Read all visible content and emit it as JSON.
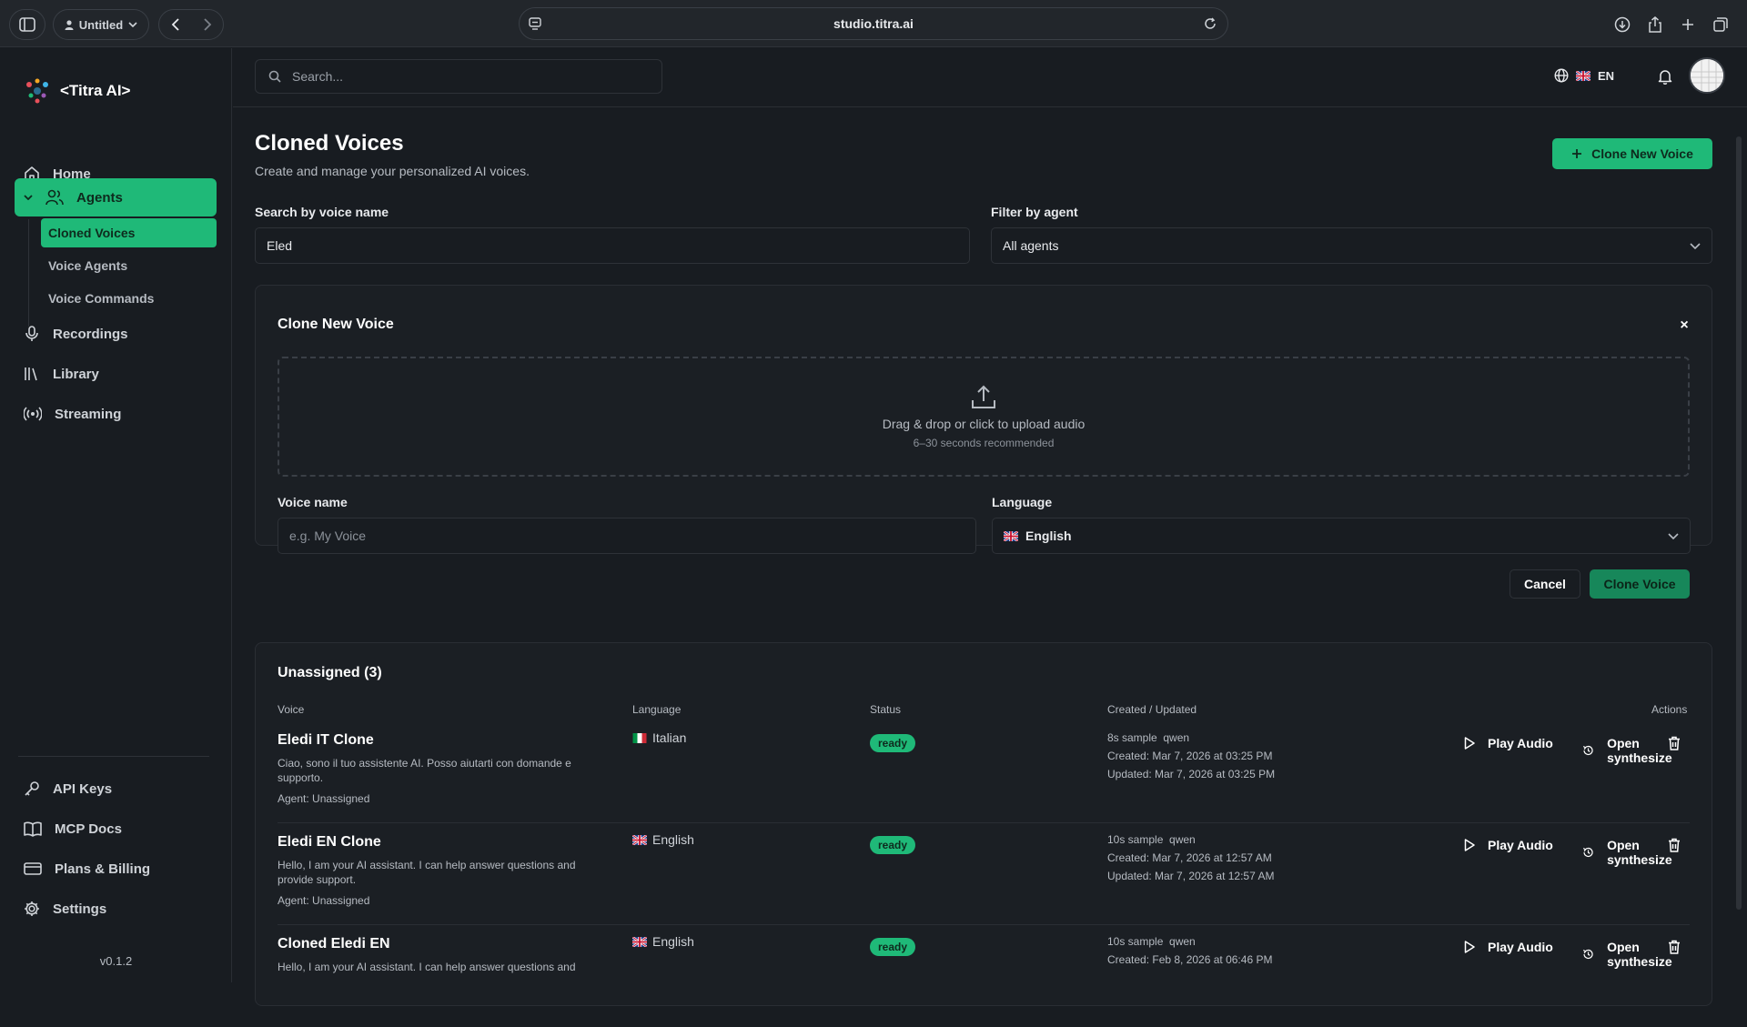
{
  "browser": {
    "profile_label": "Untitled",
    "url": "studio.titra.ai"
  },
  "app": {
    "logo_text": "<Titra AI>",
    "version": "v0.1.2",
    "accent_color": "#1fb978"
  },
  "sidebar": {
    "items": [
      {
        "label": "Home",
        "icon": "home-icon"
      },
      {
        "label": "Agents",
        "icon": "users-icon"
      },
      {
        "label": "Recordings",
        "icon": "mic-icon"
      },
      {
        "label": "Library",
        "icon": "library-icon"
      },
      {
        "label": "Streaming",
        "icon": "broadcast-icon"
      }
    ],
    "sub_items": [
      {
        "label": "Cloned Voices"
      },
      {
        "label": "Voice Agents"
      },
      {
        "label": "Voice Commands"
      }
    ],
    "bottom_items": [
      {
        "label": "API Keys",
        "icon": "key-icon"
      },
      {
        "label": "MCP Docs",
        "icon": "book-icon"
      },
      {
        "label": "Plans & Billing",
        "icon": "credit-card-icon"
      },
      {
        "label": "Settings",
        "icon": "gear-icon"
      }
    ]
  },
  "topbar": {
    "search_placeholder": "Search...",
    "language": "EN"
  },
  "page": {
    "title": "Cloned Voices",
    "subtitle": "Create and manage your personalized AI voices.",
    "clone_button": "Clone New Voice"
  },
  "filters": {
    "search_label": "Search by voice name",
    "search_value": "Eled",
    "agent_label": "Filter by agent",
    "agent_value": "All agents"
  },
  "clone_form": {
    "title": "Clone New Voice",
    "close_symbol": "×",
    "upload_text": "Drag & drop or click to upload audio",
    "upload_hint": "6–30 seconds recommended",
    "name_label": "Voice name",
    "name_placeholder": "e.g. My Voice",
    "language_label": "Language",
    "language_value": "English",
    "cancel": "Cancel",
    "submit": "Clone Voice"
  },
  "unassigned": {
    "title": "Unassigned (3)",
    "columns": [
      "Voice",
      "Language",
      "Status",
      "Created / Updated",
      "Actions"
    ],
    "play_label": "Play Audio",
    "synth_label": "Open synthesize",
    "rows": [
      {
        "name": "Eledi IT Clone",
        "description": "Ciao, sono il tuo assistente AI. Posso aiutarti con domande e supporto.",
        "agent": "Agent: Unassigned",
        "language": "Italian",
        "flag": "it",
        "status": "ready",
        "sample": "8s sample",
        "model": "qwen",
        "created": "Created: Mar 7, 2026 at 03:25 PM",
        "updated": "Updated: Mar 7, 2026 at 03:25 PM"
      },
      {
        "name": "Eledi EN Clone",
        "description": "Hello, I am your AI assistant. I can help answer questions and provide support.",
        "agent": "Agent: Unassigned",
        "language": "English",
        "flag": "gb",
        "status": "ready",
        "sample": "10s sample",
        "model": "qwen",
        "created": "Created: Mar 7, 2026 at 12:57 AM",
        "updated": "Updated: Mar 7, 2026 at 12:57 AM"
      },
      {
        "name": "Cloned Eledi EN",
        "description": "Hello, I am your AI assistant. I can help answer questions and",
        "agent": "",
        "language": "English",
        "flag": "gb",
        "status": "ready",
        "sample": "10s sample",
        "model": "qwen",
        "created": "Created: Feb 8, 2026 at 06:46 PM",
        "updated": ""
      }
    ]
  }
}
